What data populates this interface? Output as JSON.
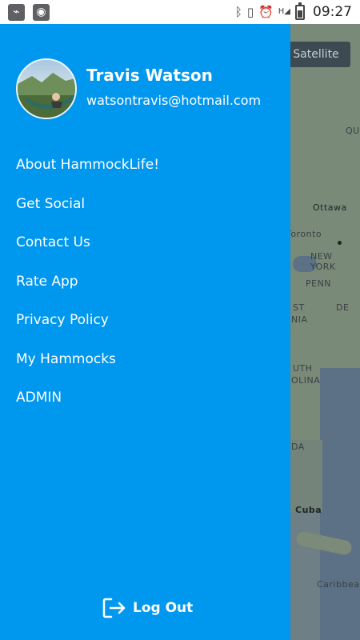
{
  "status_bar": {
    "time": "09:27",
    "icons": [
      "usb-icon",
      "android-debug-icon",
      "bluetooth-icon",
      "vibrate-icon",
      "alarm-icon",
      "signal-h-icon",
      "battery-icon"
    ]
  },
  "map": {
    "satellite_label": "Satellite",
    "labels": [
      "QU",
      "Ottawa",
      "Toronto",
      "NEW YORK",
      "PENN",
      "ST",
      "NIA",
      "DE",
      "UTH",
      "OLINA",
      "DA",
      "Cuba",
      "Caribbean"
    ]
  },
  "drawer": {
    "user": {
      "name": "Travis Watson",
      "email": "watsontravis@hotmail.com"
    },
    "menu": [
      {
        "label": "About HammockLife!"
      },
      {
        "label": "Get Social"
      },
      {
        "label": "Contact Us"
      },
      {
        "label": "Rate App"
      },
      {
        "label": "Privacy Policy"
      },
      {
        "label": "My Hammocks"
      },
      {
        "label": "ADMIN"
      }
    ],
    "logout_label": "Log Out",
    "background_color": "#0097ef"
  }
}
